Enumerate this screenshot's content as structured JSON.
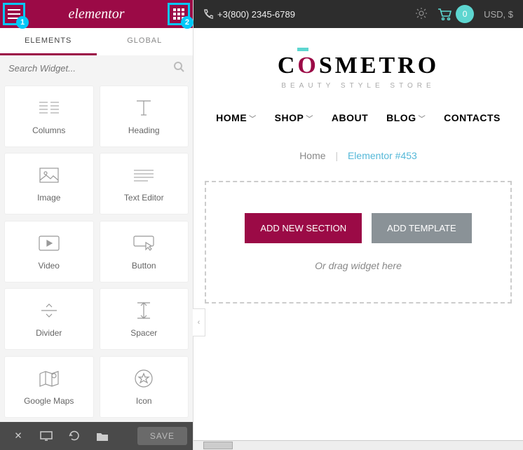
{
  "header": {
    "brand": "elementor",
    "marker1": "1",
    "marker2": "2"
  },
  "tabs": {
    "elements": "ELEMENTS",
    "global": "GLOBAL"
  },
  "search": {
    "placeholder": "Search Widget..."
  },
  "widgets": [
    {
      "label": "Columns"
    },
    {
      "label": "Heading"
    },
    {
      "label": "Image"
    },
    {
      "label": "Text Editor"
    },
    {
      "label": "Video"
    },
    {
      "label": "Button"
    },
    {
      "label": "Divider"
    },
    {
      "label": "Spacer"
    },
    {
      "label": "Google Maps"
    },
    {
      "label": "Icon"
    }
  ],
  "footer": {
    "save": "SAVE"
  },
  "topbar": {
    "phone": "+3(800) 2345-6789",
    "cart_count": "0",
    "currency": "USD, $"
  },
  "site": {
    "logo_pre": "C",
    "logo_o": "O",
    "logo_post": "SMETRO",
    "tagline": "BEAUTY STYLE STORE"
  },
  "nav": {
    "home": "HOME",
    "shop": "SHOP",
    "about": "ABOUT",
    "blog": "BLOG",
    "contacts": "CONTACTS"
  },
  "breadcrumb": {
    "home": "Home",
    "sep": "|",
    "current": "Elementor #453"
  },
  "canvas": {
    "add_section": "ADD NEW SECTION",
    "add_template": "ADD TEMPLATE",
    "hint": "Or drag widget here"
  }
}
